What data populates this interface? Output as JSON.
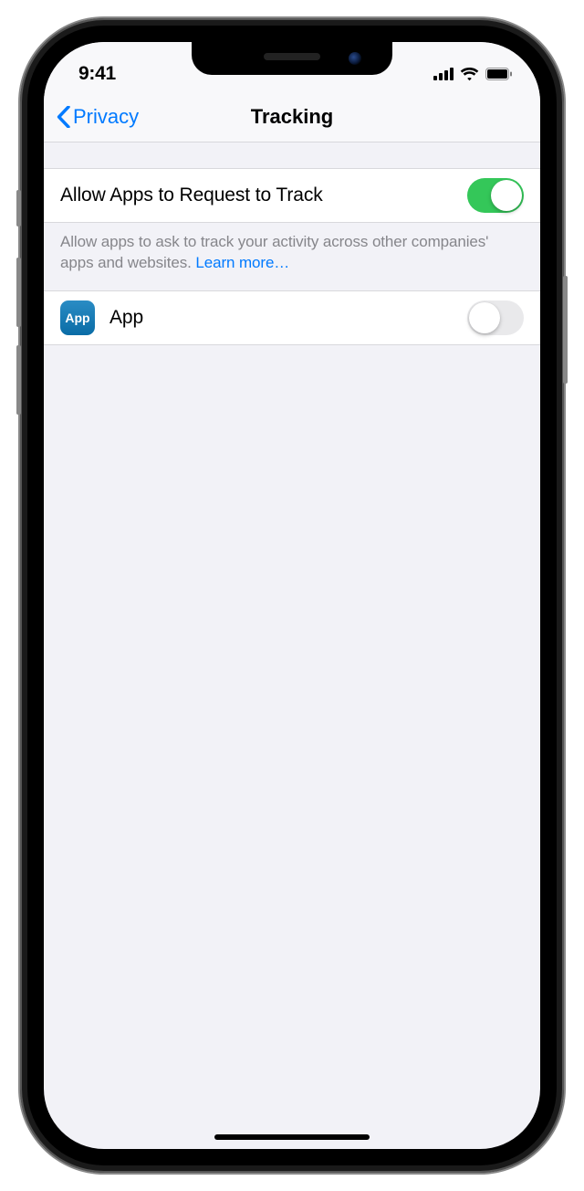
{
  "statusBar": {
    "time": "9:41"
  },
  "nav": {
    "backLabel": "Privacy",
    "title": "Tracking"
  },
  "settings": {
    "allowLabel": "Allow Apps to Request to Track",
    "allowOn": true,
    "footerText": "Allow apps to ask to track your activity across other companies' apps and websites. ",
    "learnMore": "Learn more…"
  },
  "apps": [
    {
      "iconText": "App",
      "name": "App",
      "on": false
    }
  ]
}
